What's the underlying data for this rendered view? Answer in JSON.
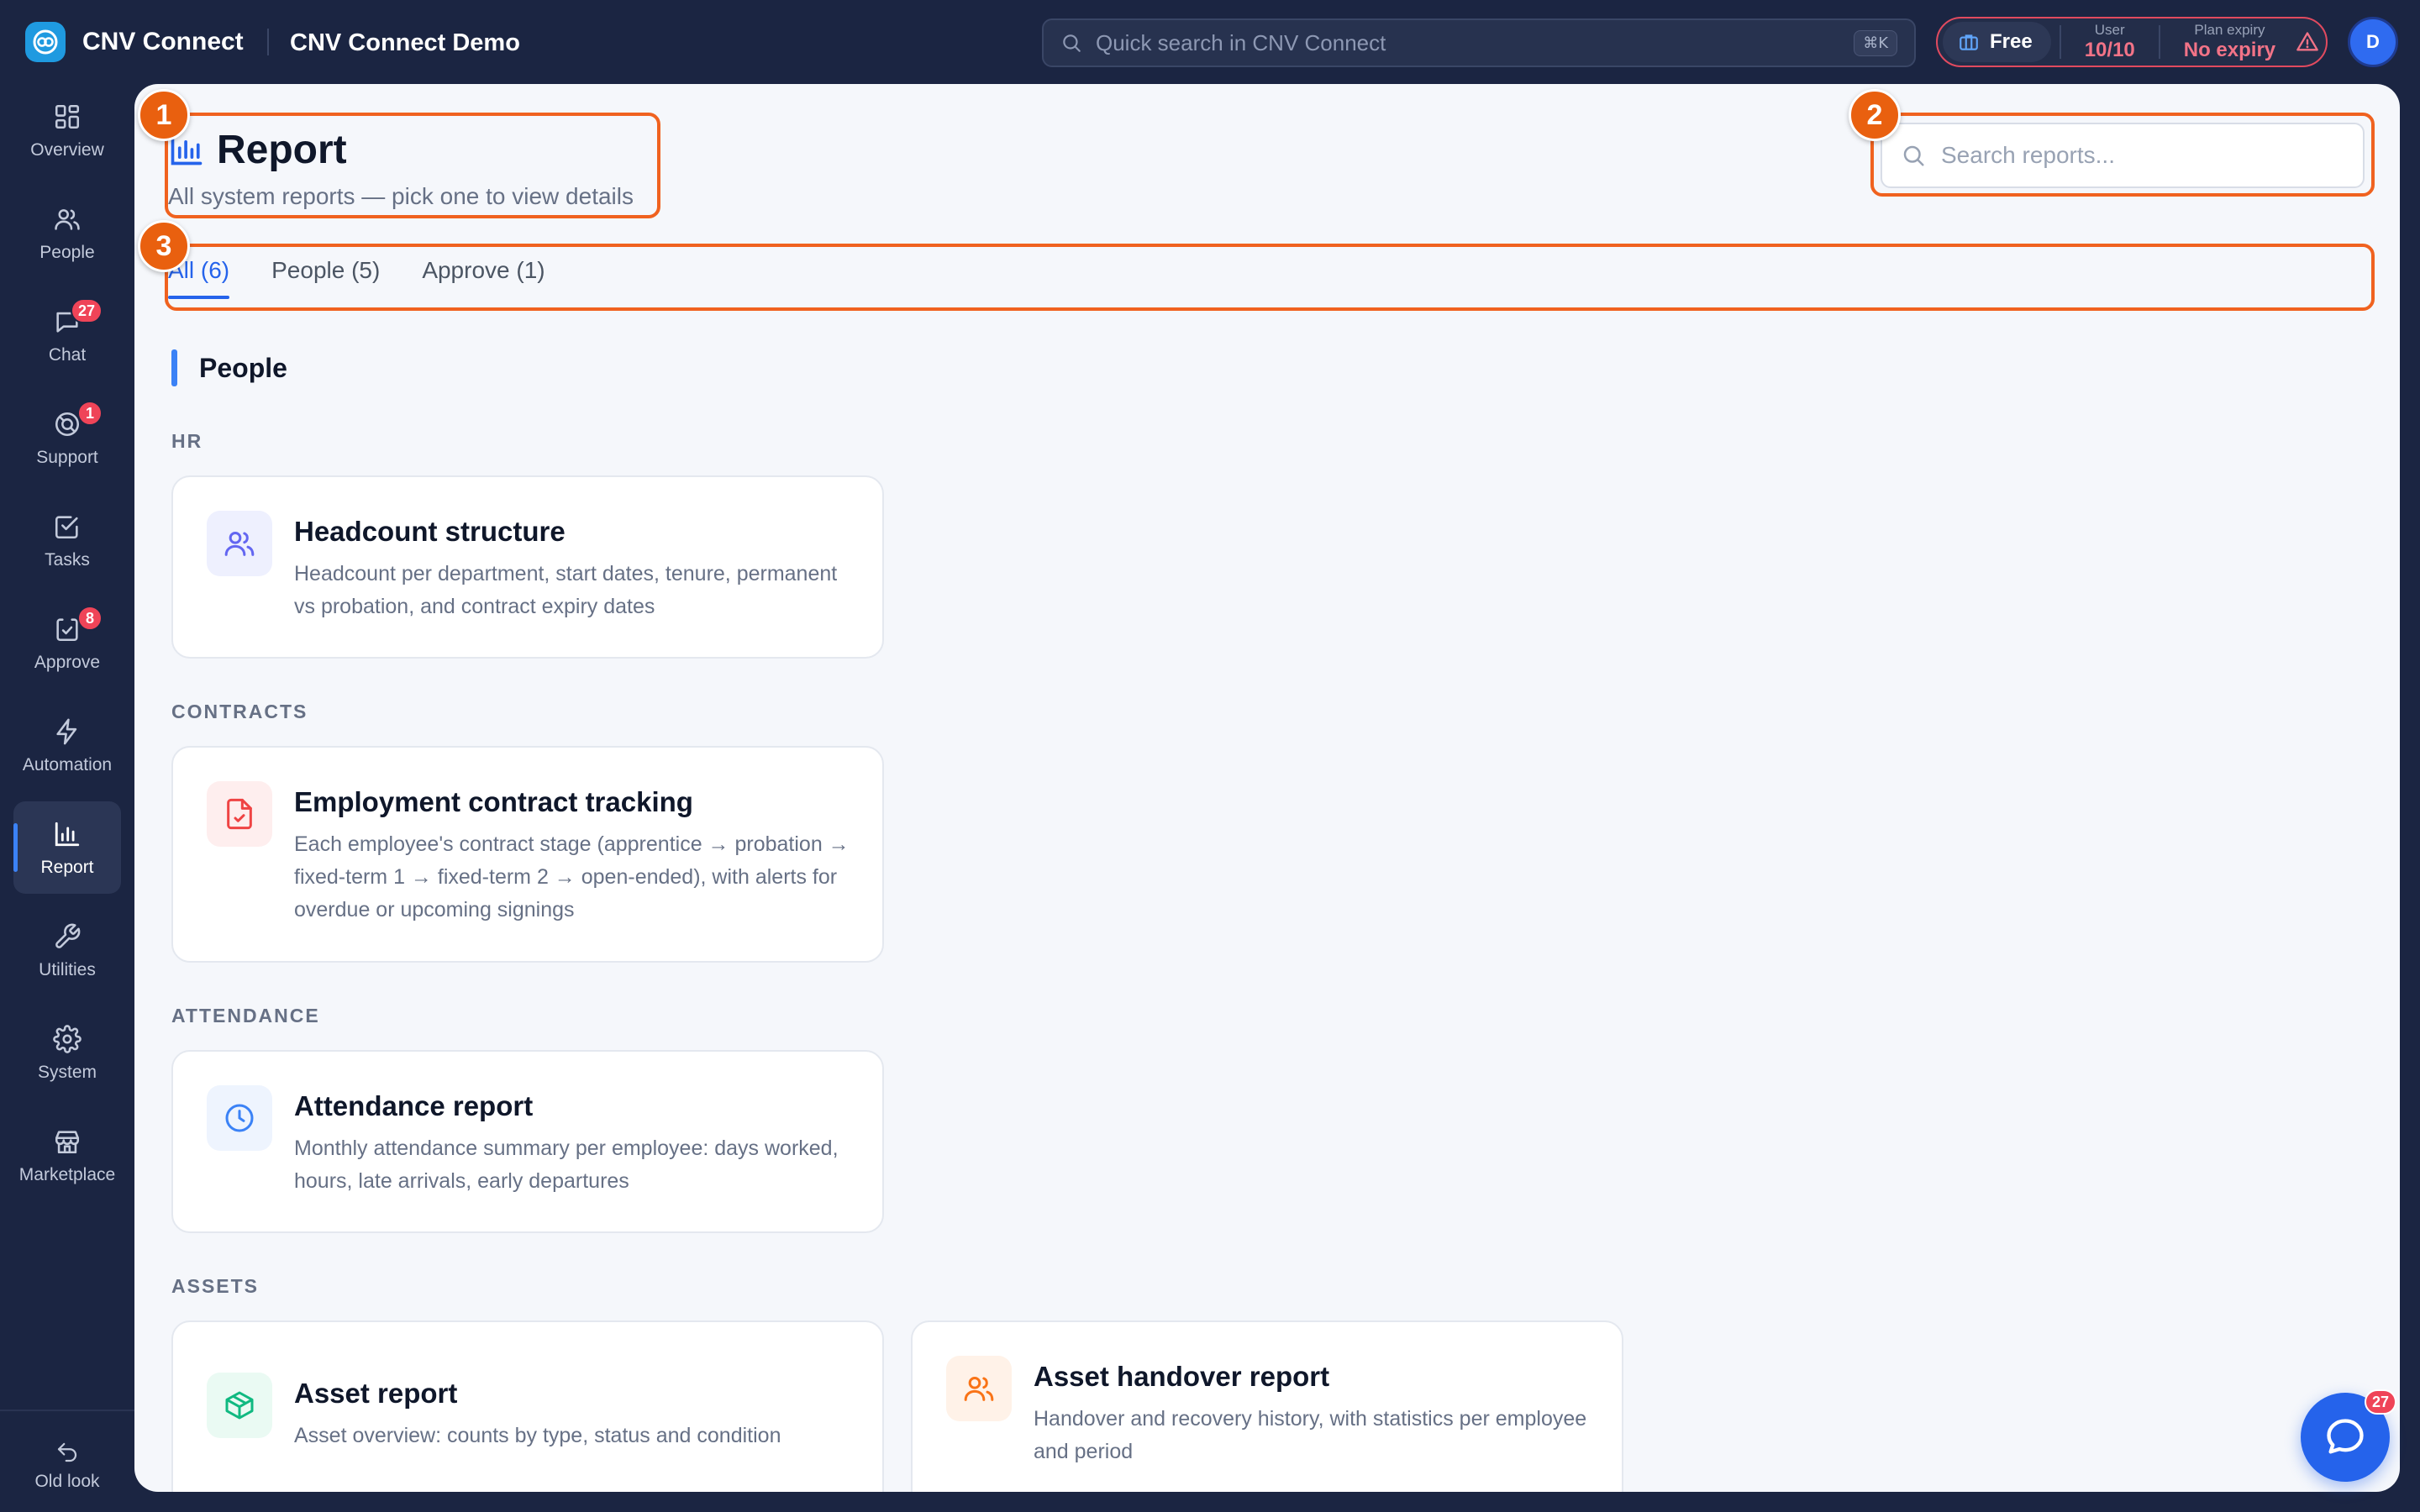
{
  "app": {
    "brand": "CNV Connect",
    "workspace": "CNV Connect Demo"
  },
  "topbar": {
    "quick_search_placeholder": "Quick search in CNV Connect",
    "shortcut": "⌘K",
    "plan": {
      "name": "Free",
      "user_label": "User",
      "user_value": "10/10",
      "expiry_label": "Plan expiry",
      "expiry_value": "No expiry"
    },
    "avatar_initial": "D"
  },
  "sidebar": {
    "items": [
      {
        "label": "Overview",
        "icon": "grid-icon"
      },
      {
        "label": "People",
        "icon": "people-icon"
      },
      {
        "label": "Chat",
        "icon": "chat-icon",
        "badge": "27"
      },
      {
        "label": "Support",
        "icon": "support-icon",
        "badge": "1"
      },
      {
        "label": "Tasks",
        "icon": "check-square-icon"
      },
      {
        "label": "Approve",
        "icon": "approve-icon",
        "badge": "8"
      },
      {
        "label": "Automation",
        "icon": "lightning-icon"
      },
      {
        "label": "Report",
        "icon": "bar-chart-icon",
        "active": true
      },
      {
        "label": "Utilities",
        "icon": "wrench-icon"
      },
      {
        "label": "System",
        "icon": "gear-icon"
      },
      {
        "label": "Marketplace",
        "icon": "store-icon"
      }
    ],
    "old_look": "Old look"
  },
  "page": {
    "title": "Report",
    "subtitle": "All system reports — pick one to view details",
    "search_placeholder": "Search reports...",
    "tabs": [
      {
        "label": "All (6)",
        "active": true
      },
      {
        "label": "People (5)"
      },
      {
        "label": "Approve (1)"
      }
    ],
    "section": "People",
    "groups": {
      "hr": "HR",
      "contracts": "CONTRACTS",
      "attendance": "ATTENDANCE",
      "assets": "ASSETS"
    },
    "cards": {
      "headcount": {
        "title": "Headcount structure",
        "desc": "Headcount per department, start dates, tenure, permanent vs probation, and contract expiry dates",
        "icon": "people-icon",
        "color": "#6366f1"
      },
      "contract": {
        "title": "Employment contract tracking",
        "desc": "Each employee's contract stage (apprentice → probation → fixed-term 1 → fixed-term 2 → open-ended), with alerts for overdue or upcoming signings",
        "icon": "file-check-icon",
        "color": "#ef4444"
      },
      "attendance": {
        "title": "Attendance report",
        "desc": "Monthly attendance summary per employee: days worked, hours, late arrivals, early departures",
        "icon": "clock-icon",
        "color": "#3b82f6"
      },
      "asset": {
        "title": "Asset report",
        "desc": "Asset overview: counts by type, status and condition",
        "icon": "box-icon",
        "color": "#10b981"
      },
      "handover": {
        "title": "Asset handover report",
        "desc": "Handover and recovery history, with statistics per employee and period",
        "icon": "people-icon",
        "color": "#f97316"
      }
    }
  },
  "annotations": [
    "1",
    "2",
    "3"
  ],
  "chat_fab_badge": "27",
  "colors": {
    "accent": "#2563eb",
    "annotation": "#f0621f",
    "sidebar_bg": "#1b2542",
    "badge": "#ef4458"
  }
}
